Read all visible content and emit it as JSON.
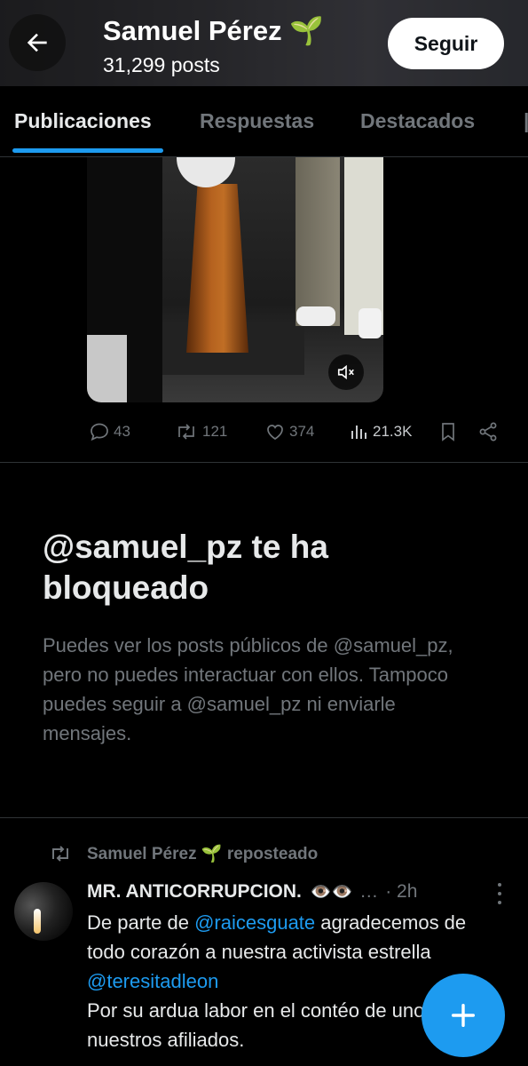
{
  "header": {
    "name": "Samuel Pérez",
    "name_emoji": "🌱",
    "posts_count": "31,299 posts",
    "follow_label": "Seguir"
  },
  "tabs": [
    {
      "label": "Publicaciones",
      "active": true
    },
    {
      "label": "Respuestas",
      "active": false
    },
    {
      "label": "Destacados",
      "active": false
    }
  ],
  "post_actions": {
    "replies": "43",
    "reposts": "121",
    "likes": "374",
    "views": "21.3K"
  },
  "blocked": {
    "title": "@samuel_pz te ha bloqueado",
    "text": "Puedes ver los posts públicos de @samuel_pz, pero no puedes interactuar con ellos. Tampoco puedes seguir a @samuel_pz ni enviarle mensajes."
  },
  "repost": {
    "by": "Samuel Pérez",
    "by_emoji": "🌱",
    "suffix": "reposteado",
    "author": "MR. ANTICORRUPCION.",
    "author_emoji": "👁️👁️",
    "ellipsis": "…",
    "time": "· 2h",
    "body": {
      "part1": "De parte de ",
      "mention1": "@raicesguate",
      "part2": " agradecemos de todo corazón a  nuestra activista estrella ",
      "mention2": "@teresitadleon",
      "part3": "Por su ardua labor en el contéo de uno de nuestros afiliados."
    }
  },
  "colors": {
    "accent": "#1d9bf0",
    "muted": "#71767b",
    "background": "#000000"
  },
  "icons": [
    "back-arrow-icon",
    "mute-icon",
    "reply-icon",
    "repost-icon",
    "like-icon",
    "views-icon",
    "bookmark-icon",
    "share-icon",
    "plus-icon",
    "more-vertical-icon"
  ]
}
